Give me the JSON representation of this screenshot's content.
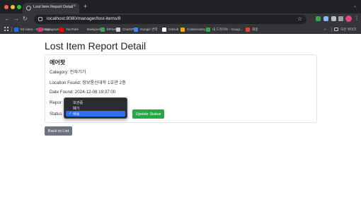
{
  "browser": {
    "tab_title": "Lost Item Report Detail",
    "tab_close": "×",
    "new_tab": "+",
    "tab_expand": "⌄",
    "url": "localhost:8080/manager/lost-items/8",
    "nav": {
      "back": "←",
      "forward": "→",
      "reload": "↻"
    },
    "star": "☆",
    "menu": "⋮",
    "accent_colors": {
      "profile": "#e8437d",
      "green_ext": "#34a853",
      "blue_ext": "#8ab4f8"
    }
  },
  "bookmarks": {
    "items": [
      {
        "label": "hd video - Symbolgy...",
        "color": "#1a73e8"
      },
      {
        "label": "Instagram",
        "color": "#e1306c"
      },
      {
        "label": "YouTube",
        "color": "#ff0000"
      },
      {
        "label": "Baekjoon",
        "color": ""
      },
      {
        "label": "bfFeers",
        "color": "#34a853"
      },
      {
        "label": "ChatGPT",
        "color": "#cfcfcf"
      },
      {
        "label": "Google 번역",
        "color": "#4285f4"
      },
      {
        "label": "GitHub",
        "color": "#ffffff"
      },
      {
        "label": "Colaboratory",
        "color": "#f9ab00"
      },
      {
        "label": "내 드라이브 - Googl...",
        "color": "#34a853"
      },
      {
        "label": "해봄",
        "color": "#ea4335"
      }
    ],
    "overflow": "»",
    "all_bookmarks": "모든 북마크"
  },
  "page": {
    "title": "Lost Item Report Detail",
    "item_name": "에어팟",
    "category": "Category: 전자기기",
    "location": "Location Found: 정보통신대학 1호관 2층",
    "date": "Date Found: 2024-12-08 19:37:00",
    "report_label": "Repor",
    "status_label": "Status",
    "update_button": "Update Status",
    "back_button": "Back to List"
  },
  "status_dropdown": {
    "options": [
      "보관중",
      "폐기",
      "배송"
    ],
    "selected_index": 2,
    "check": "✓"
  },
  "colors": {
    "success": "#28a745",
    "secondary": "#6c757d",
    "selection": "#2d6ff3"
  }
}
